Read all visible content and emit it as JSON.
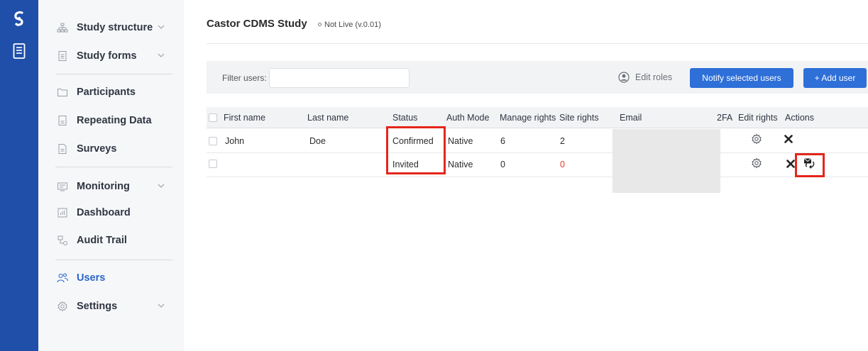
{
  "rail": {
    "logo_icon": "castor-logo-icon",
    "study_icon": "notebook-icon",
    "color": "#1f4fa8"
  },
  "sidebar": {
    "items": [
      {
        "label": "Study structure",
        "icon": "hierarchy-icon",
        "chevron": true
      },
      {
        "label": "Study forms",
        "icon": "document-icon",
        "chevron": true
      },
      {
        "label": "Participants",
        "icon": "folder-icon",
        "chevron": false
      },
      {
        "label": "Repeating Data",
        "icon": "list-document-icon",
        "chevron": false
      },
      {
        "label": "Surveys",
        "icon": "survey-icon",
        "chevron": false
      },
      {
        "label": "Monitoring",
        "icon": "monitor-icon",
        "chevron": true
      },
      {
        "label": "Dashboard",
        "icon": "bar-chart-icon",
        "chevron": false
      },
      {
        "label": "Audit Trail",
        "icon": "audit-icon",
        "chevron": false
      },
      {
        "label": "Users",
        "icon": "users-icon",
        "chevron": false,
        "active": true
      },
      {
        "label": "Settings",
        "icon": "gear-icon",
        "chevron": true
      }
    ]
  },
  "header": {
    "title": "Castor CDMS Study",
    "status": "Not Live (v.0.01)"
  },
  "toolbar": {
    "filter_label": "Filter users:",
    "filter_value": "",
    "edit_roles_label": "Edit roles",
    "notify_label": "Notify selected users",
    "add_user_label": "+ Add user",
    "accent": "#2e6fd8"
  },
  "table": {
    "columns": [
      "First name",
      "Last name",
      "Status",
      "Auth Mode",
      "Manage rights",
      "Site rights",
      "Email",
      "2FA",
      "Edit rights",
      "Actions"
    ],
    "rows": [
      {
        "first_name": "John",
        "last_name": "Doe",
        "status": "Confirmed",
        "auth_mode": "Native",
        "manage_rights": "6",
        "site_rights": "2",
        "email": "",
        "twofa": ""
      },
      {
        "first_name": "",
        "last_name": "",
        "status": "Invited",
        "auth_mode": "Native",
        "manage_rights": "0",
        "site_rights": "0",
        "email": "",
        "twofa": "",
        "site_rights_color": "#e23b2e"
      }
    ]
  },
  "highlight_color": "#e4261b"
}
